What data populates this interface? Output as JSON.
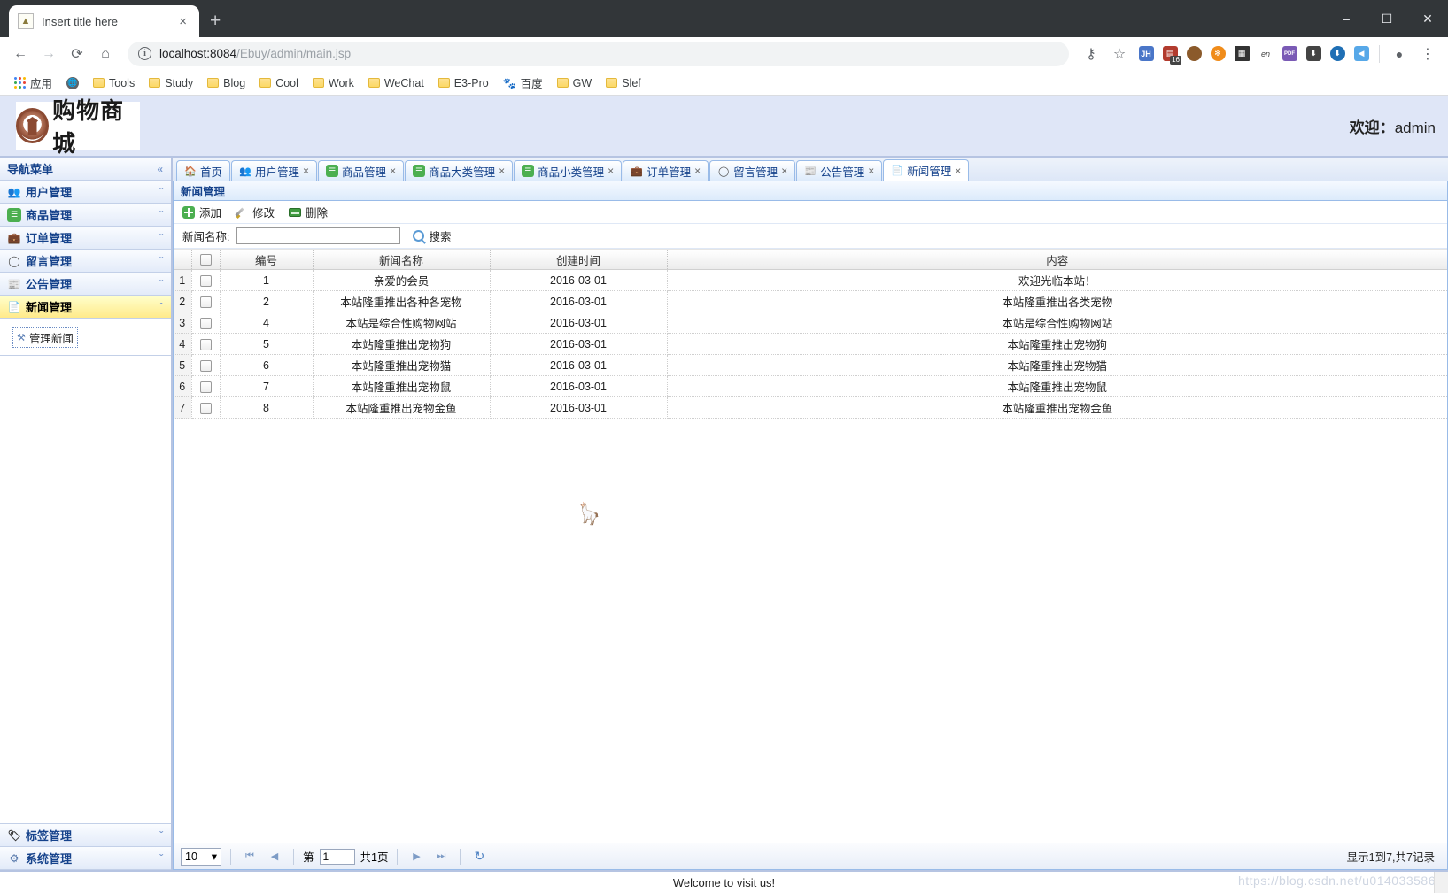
{
  "browser": {
    "tab": {
      "title": "Insert title here",
      "favicon_icon": "page-favicon",
      "close_label": "×"
    },
    "newtab_label": "+",
    "window": {
      "minimize": "–",
      "maximize": "☐",
      "close": "✕"
    },
    "nav": {
      "back": "←",
      "forward": "→",
      "reload": "⟳",
      "home": "⌂"
    },
    "omnibox": {
      "info_glyph": "i",
      "url_host": "localhost:8084",
      "url_path": "/Ebuy/admin/main.jsp",
      "full_url": "localhost:8084/Ebuy/admin/main.jsp",
      "key_icon": "⚷",
      "star_icon": "☆"
    },
    "extensions": [
      {
        "name": "jh-extension",
        "label": "JH",
        "color": "#4a76c8"
      },
      {
        "name": "red-tool-extension",
        "label": "▤",
        "color": "#b23b2e",
        "badge": "16"
      },
      {
        "name": "monkey-extension",
        "label": "●",
        "color": "#8b5a2b"
      },
      {
        "name": "orange-circle-extension",
        "label": "✻",
        "color": "#f08c1a"
      },
      {
        "name": "qrcode-extension",
        "label": "▦",
        "color": "#333333"
      },
      {
        "name": "translate-extension",
        "label": "en",
        "color": "#444444"
      },
      {
        "name": "pdf-extension",
        "label": "PDF",
        "color": "#7a5ab5"
      },
      {
        "name": "download-extension",
        "label": "⬇",
        "color": "#444444"
      },
      {
        "name": "idm-extension",
        "label": "⬇",
        "color": "#1f6fb5"
      },
      {
        "name": "thunder-extension",
        "label": "◀",
        "color": "#57a8e8"
      }
    ],
    "profile_icon": "●",
    "menu_icon": "⋮",
    "bookmarks": [
      {
        "name": "apps",
        "label": "应用",
        "icon": "apps-grid-icon"
      },
      {
        "name": "globe",
        "label": "",
        "icon": "globe-icon"
      },
      {
        "name": "tools",
        "label": "Tools",
        "icon": "folder-icon"
      },
      {
        "name": "study",
        "label": "Study",
        "icon": "folder-icon"
      },
      {
        "name": "blog",
        "label": "Blog",
        "icon": "folder-icon"
      },
      {
        "name": "cool",
        "label": "Cool",
        "icon": "folder-icon"
      },
      {
        "name": "work",
        "label": "Work",
        "icon": "folder-icon"
      },
      {
        "name": "wechat",
        "label": "WeChat",
        "icon": "folder-icon"
      },
      {
        "name": "e3-pro",
        "label": "E3-Pro",
        "icon": "folder-icon"
      },
      {
        "name": "baidu",
        "label": "百度",
        "icon": "baidu-paw-icon"
      },
      {
        "name": "gw",
        "label": "GW",
        "icon": "folder-icon"
      },
      {
        "name": "slef",
        "label": "Slef",
        "icon": "folder-icon"
      }
    ]
  },
  "header": {
    "logo_text": "购物商城",
    "welcome_label": "欢迎：",
    "user": "admin"
  },
  "sidebar": {
    "title": "导航菜单",
    "collapse_icon": "«",
    "items": [
      {
        "label": "用户管理",
        "icon": "users-icon",
        "glyph": "👥",
        "color": "#5b9bd5",
        "expanded": false
      },
      {
        "label": "商品管理",
        "icon": "list-icon",
        "glyph": "☰",
        "color": "#4caf50",
        "expanded": false
      },
      {
        "label": "订单管理",
        "icon": "folder-yellow-icon",
        "glyph": "▤",
        "color": "#e8b400",
        "expanded": false
      },
      {
        "label": "留言管理",
        "icon": "speech-bubble-icon",
        "glyph": "◯",
        "color": "#555555",
        "expanded": false
      },
      {
        "label": "公告管理",
        "icon": "newspaper-icon",
        "glyph": "▥",
        "color": "#777777",
        "expanded": false
      },
      {
        "label": "新闻管理",
        "icon": "news-icon",
        "glyph": "▦",
        "color": "#888888",
        "expanded": true
      }
    ],
    "expanded_children": [
      {
        "label": "管理新闻",
        "icon": "tools-icon",
        "glyph": "⚒"
      }
    ],
    "bottom_items": [
      {
        "label": "标签管理",
        "icon": "tag-icon",
        "glyph": "◆"
      },
      {
        "label": "系统管理",
        "icon": "gear-icon",
        "glyph": "⚙"
      }
    ],
    "chevron_down": "ˇ",
    "chevron_up": "ˆ"
  },
  "tabs": [
    {
      "label": "首页",
      "icon": "home-icon",
      "glyph": "⌂",
      "color": "#3f8ad8",
      "closable": false,
      "active": false
    },
    {
      "label": "用户管理",
      "icon": "users-icon",
      "glyph": "👥",
      "color": "#5b9bd5",
      "closable": true,
      "active": false
    },
    {
      "label": "商品管理",
      "icon": "list-icon",
      "glyph": "☰",
      "color": "#4caf50",
      "closable": true,
      "active": false
    },
    {
      "label": "商品大类管理",
      "icon": "list-icon",
      "glyph": "☰",
      "color": "#4caf50",
      "closable": true,
      "active": false
    },
    {
      "label": "商品小类管理",
      "icon": "list-icon",
      "glyph": "☰",
      "color": "#4caf50",
      "closable": true,
      "active": false
    },
    {
      "label": "订单管理",
      "icon": "folder-yellow-icon",
      "glyph": "▤",
      "color": "#e8b400",
      "closable": true,
      "active": false
    },
    {
      "label": "留言管理",
      "icon": "speech-bubble-icon",
      "glyph": "◯",
      "color": "#555555",
      "closable": true,
      "active": false
    },
    {
      "label": "公告管理",
      "icon": "newspaper-icon",
      "glyph": "▥",
      "color": "#777777",
      "closable": true,
      "active": false
    },
    {
      "label": "新闻管理",
      "icon": "news-icon",
      "glyph": "▦",
      "color": "#888888",
      "closable": true,
      "active": true
    }
  ],
  "tab_close_glyph": "×",
  "panel": {
    "title": "新闻管理",
    "toolbar": [
      {
        "label": "添加",
        "icon": "add-icon"
      },
      {
        "label": "修改",
        "icon": "edit-icon"
      },
      {
        "label": "删除",
        "icon": "delete-icon"
      }
    ],
    "search": {
      "label": "新闻名称:",
      "value": "",
      "placeholder": "",
      "button_label": "搜索",
      "button_icon": "search-icon"
    }
  },
  "table": {
    "columns": [
      "",
      "",
      "编号",
      "新闻名称",
      "创建时间",
      "内容"
    ],
    "rows": [
      {
        "index": "1",
        "id": "1",
        "name": "亲爱的会员",
        "created": "2016-03-01",
        "content": "欢迎光临本站！"
      },
      {
        "index": "2",
        "id": "2",
        "name": "本站隆重推出各种各宠物",
        "created": "2016-03-01",
        "content": "本站隆重推出各类宠物"
      },
      {
        "index": "3",
        "id": "4",
        "name": "本站是综合性购物网站",
        "created": "2016-03-01",
        "content": "本站是综合性购物网站"
      },
      {
        "index": "4",
        "id": "5",
        "name": "本站隆重推出宠物狗",
        "created": "2016-03-01",
        "content": "本站隆重推出宠物狗"
      },
      {
        "index": "5",
        "id": "6",
        "name": "本站隆重推出宠物猫",
        "created": "2016-03-01",
        "content": "本站隆重推出宠物猫"
      },
      {
        "index": "6",
        "id": "7",
        "name": "本站隆重推出宠物鼠",
        "created": "2016-03-01",
        "content": "本站隆重推出宠物鼠"
      },
      {
        "index": "7",
        "id": "8",
        "name": "本站隆重推出宠物金鱼",
        "created": "2016-03-01",
        "content": "本站隆重推出宠物金鱼"
      }
    ]
  },
  "pager": {
    "page_size": "10",
    "page_size_caret": "▾",
    "first_icon": "⏮",
    "prev_icon": "◀",
    "page_prefix": "第",
    "page_value": "1",
    "page_suffix": "共1页",
    "next_icon": "▶",
    "last_icon": "⏭",
    "refresh_icon": "↻",
    "summary": "显示1到7,共7记录"
  },
  "footer": {
    "text": "Welcome to visit us!",
    "watermark": "https://blog.csdn.net/u014033586"
  }
}
